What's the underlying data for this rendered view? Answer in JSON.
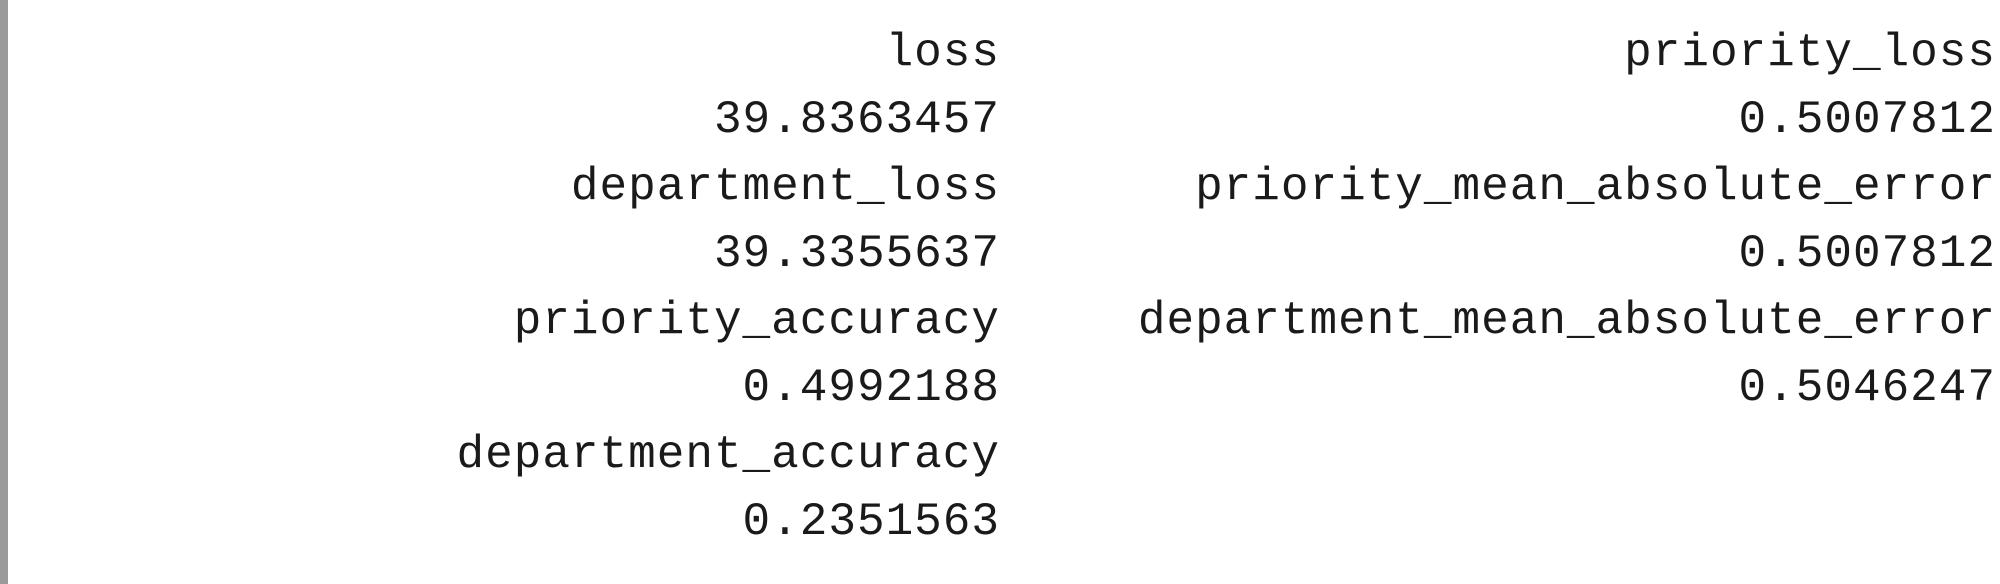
{
  "metrics": {
    "rows": [
      {
        "col1": {
          "name": "loss",
          "value": "39.8363457"
        },
        "col2": {
          "name": "priority_loss",
          "value": "0.5007812"
        }
      },
      {
        "col1": {
          "name": "department_loss",
          "value": "39.3355637"
        },
        "col2": {
          "name": "priority_mean_absolute_error",
          "value": "0.5007812"
        }
      },
      {
        "col1": {
          "name": "priority_accuracy",
          "value": "0.4992188"
        },
        "col2": {
          "name": "department_mean_absolute_error",
          "value": "0.5046247"
        }
      },
      {
        "col1": {
          "name": "department_accuracy",
          "value": "0.2351563"
        }
      }
    ]
  }
}
